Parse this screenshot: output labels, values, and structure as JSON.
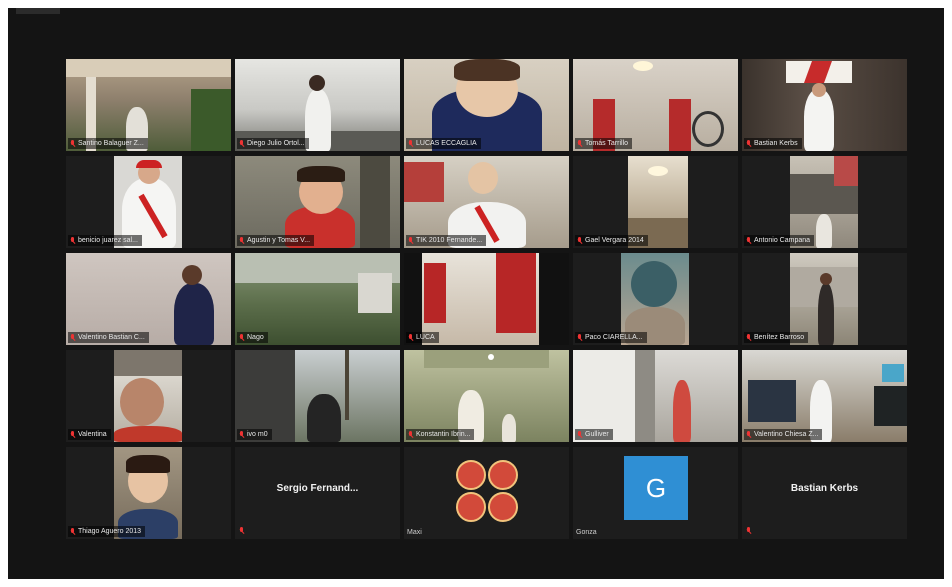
{
  "participants": [
    {
      "name": "Santino Balaguer Z...",
      "muted": true
    },
    {
      "name": "Diego Julio Ortol...",
      "muted": true
    },
    {
      "name": "LUCAS ECCAGLIA",
      "muted": true
    },
    {
      "name": "Tomás Tarrillo",
      "muted": true
    },
    {
      "name": "Bastian Kerbs",
      "muted": true
    },
    {
      "name": "benicio juarez sal...",
      "muted": true
    },
    {
      "name": "Agustin y Tomas V...",
      "muted": true
    },
    {
      "name": "TIK 2010 Fernande...",
      "muted": true
    },
    {
      "name": "Gael Vergara 2014",
      "muted": true
    },
    {
      "name": "Antonio Campana",
      "muted": true
    },
    {
      "name": "Valentino Bastian C...",
      "muted": true
    },
    {
      "name": "Nago",
      "muted": true
    },
    {
      "name": "LUCA",
      "muted": true
    },
    {
      "name": "Paco CIARELLA...",
      "muted": true
    },
    {
      "name": "Benítez Barroso",
      "muted": true
    },
    {
      "name": "Valentina",
      "muted": true
    },
    {
      "name": "ivo m0",
      "muted": true
    },
    {
      "name": "Konstantin Ibrin...",
      "muted": true
    },
    {
      "name": "Gulliver",
      "muted": true
    },
    {
      "name": "Valentino Chiesa Z...",
      "muted": true
    },
    {
      "name": "Thiago Aguero 2013",
      "muted": true
    },
    {
      "name": "Sergio Fernand...",
      "muted": true
    },
    {
      "name": "Maxi",
      "muted": false
    },
    {
      "name": "Gonza",
      "muted": false
    },
    {
      "name": "Bastian Kerbs",
      "muted": true
    }
  ],
  "avatar_letter": "G",
  "colors": {
    "background": "#141414",
    "tile": "#1d1d1d",
    "avatar": "#2f8fd4",
    "muted_icon": "#e33333"
  }
}
